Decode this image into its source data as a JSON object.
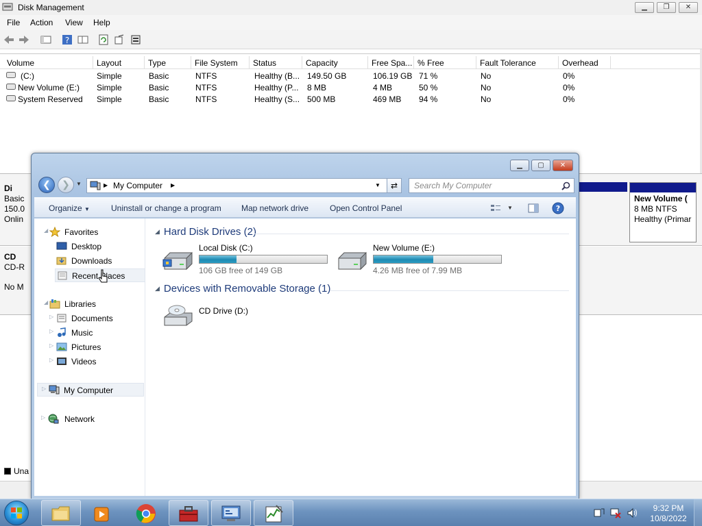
{
  "disk_mgmt": {
    "title": "Disk Management",
    "menu": [
      "File",
      "Action",
      "View",
      "Help"
    ],
    "columns": [
      "Volume",
      "Layout",
      "Type",
      "File System",
      "Status",
      "Capacity",
      "Free Spa...",
      "% Free",
      "Fault Tolerance",
      "Overhead"
    ],
    "rows": [
      [
        "(C:)",
        "Simple",
        "Basic",
        "NTFS",
        "Healthy (B...",
        "149.50 GB",
        "106.19 GB",
        "71 %",
        "No",
        "0%"
      ],
      [
        "New Volume (E:)",
        "Simple",
        "Basic",
        "NTFS",
        "Healthy (P...",
        "8 MB",
        "4 MB",
        "50 %",
        "No",
        "0%"
      ],
      [
        "System Reserved",
        "Simple",
        "Basic",
        "NTFS",
        "Healthy (S...",
        "500 MB",
        "469 MB",
        "94 %",
        "No",
        "0%"
      ]
    ],
    "disk0": {
      "name": "Di",
      "type": "Basic",
      "size": "150.0",
      "state": "Onlin"
    },
    "cd0": {
      "name": "CD",
      "type": "CD-R",
      "media": "No M"
    },
    "vol_e": {
      "name": "New Volume (",
      "size": "8 MB NTFS",
      "status": "Healthy (Primar"
    },
    "legend": {
      "unallocated": "Una"
    }
  },
  "explorer": {
    "breadcrumb": "My Computer",
    "search_placeholder": "Search My Computer",
    "commands": [
      "Organize",
      "Uninstall or change a program",
      "Map network drive",
      "Open Control Panel"
    ],
    "nav": {
      "favorites": "Favorites",
      "desktop": "Desktop",
      "downloads": "Downloads",
      "recent": "Recent Places",
      "libraries": "Libraries",
      "documents": "Documents",
      "music": "Music",
      "pictures": "Pictures",
      "videos": "Videos",
      "computer": "My Computer",
      "network": "Network"
    },
    "groups": {
      "hdd": "Hard Disk Drives (2)",
      "removable": "Devices with Removable Storage (1)"
    },
    "drives": [
      {
        "name": "Local Disk (C:)",
        "free": "106 GB free of 149 GB",
        "used_fraction": 0.29
      },
      {
        "name": "New Volume (E:)",
        "free": "4.26 MB free of 7.99 MB",
        "used_fraction": 0.47
      }
    ],
    "cd": {
      "name": "CD Drive (D:)"
    }
  },
  "taskbar": {
    "time": "9:32 PM",
    "date": "10/8/2022"
  },
  "colors": {
    "progress_fill": "#1e8ab3",
    "disk_bar": "#101a8c",
    "taskbar": "#6d93bf"
  }
}
